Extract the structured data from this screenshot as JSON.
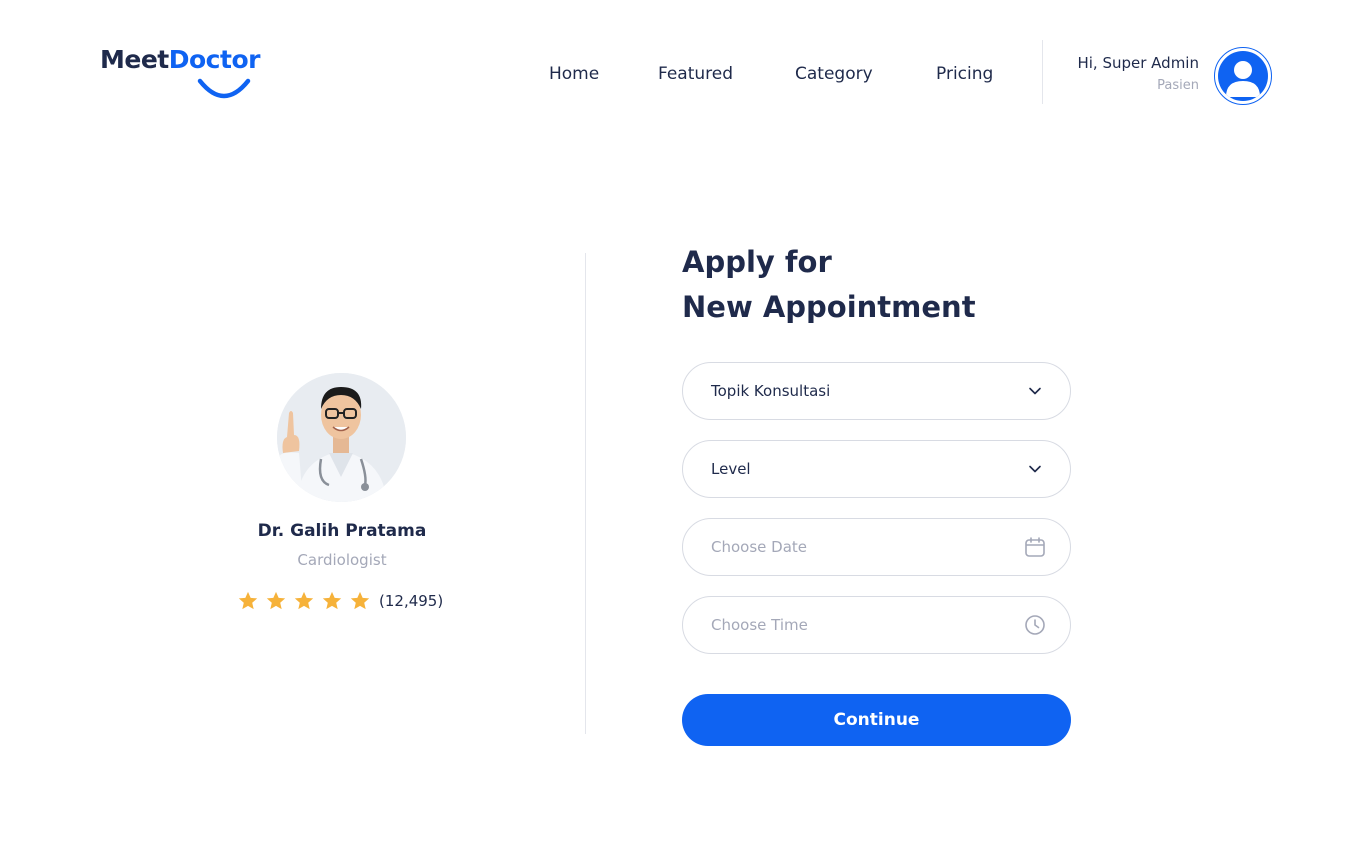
{
  "brand": {
    "name_part1": "Meet",
    "name_part2": "Doctor"
  },
  "nav": {
    "items": [
      "Home",
      "Featured",
      "Category",
      "Pricing"
    ]
  },
  "user": {
    "greeting": "Hi, Super Admin",
    "role": "Pasien"
  },
  "doctor": {
    "name": "Dr. Galih Pratama",
    "specialty": "Cardiologist",
    "rating_stars": 5,
    "rating_count": "(12,495)"
  },
  "form": {
    "title_line1": "Apply for",
    "title_line2": "New Appointment",
    "topic": {
      "value": "Topik Konsultasi",
      "icon": "chevron-down-icon"
    },
    "level": {
      "value": "Level",
      "icon": "chevron-down-icon"
    },
    "date": {
      "placeholder": "Choose Date",
      "icon": "calendar-icon"
    },
    "time": {
      "placeholder": "Choose Time",
      "icon": "clock-icon"
    },
    "submit_label": "Continue"
  },
  "colors": {
    "primary": "#0f63f2",
    "text": "#1f2a4b",
    "muted": "#a4a8b8",
    "star": "#f6b23a"
  }
}
